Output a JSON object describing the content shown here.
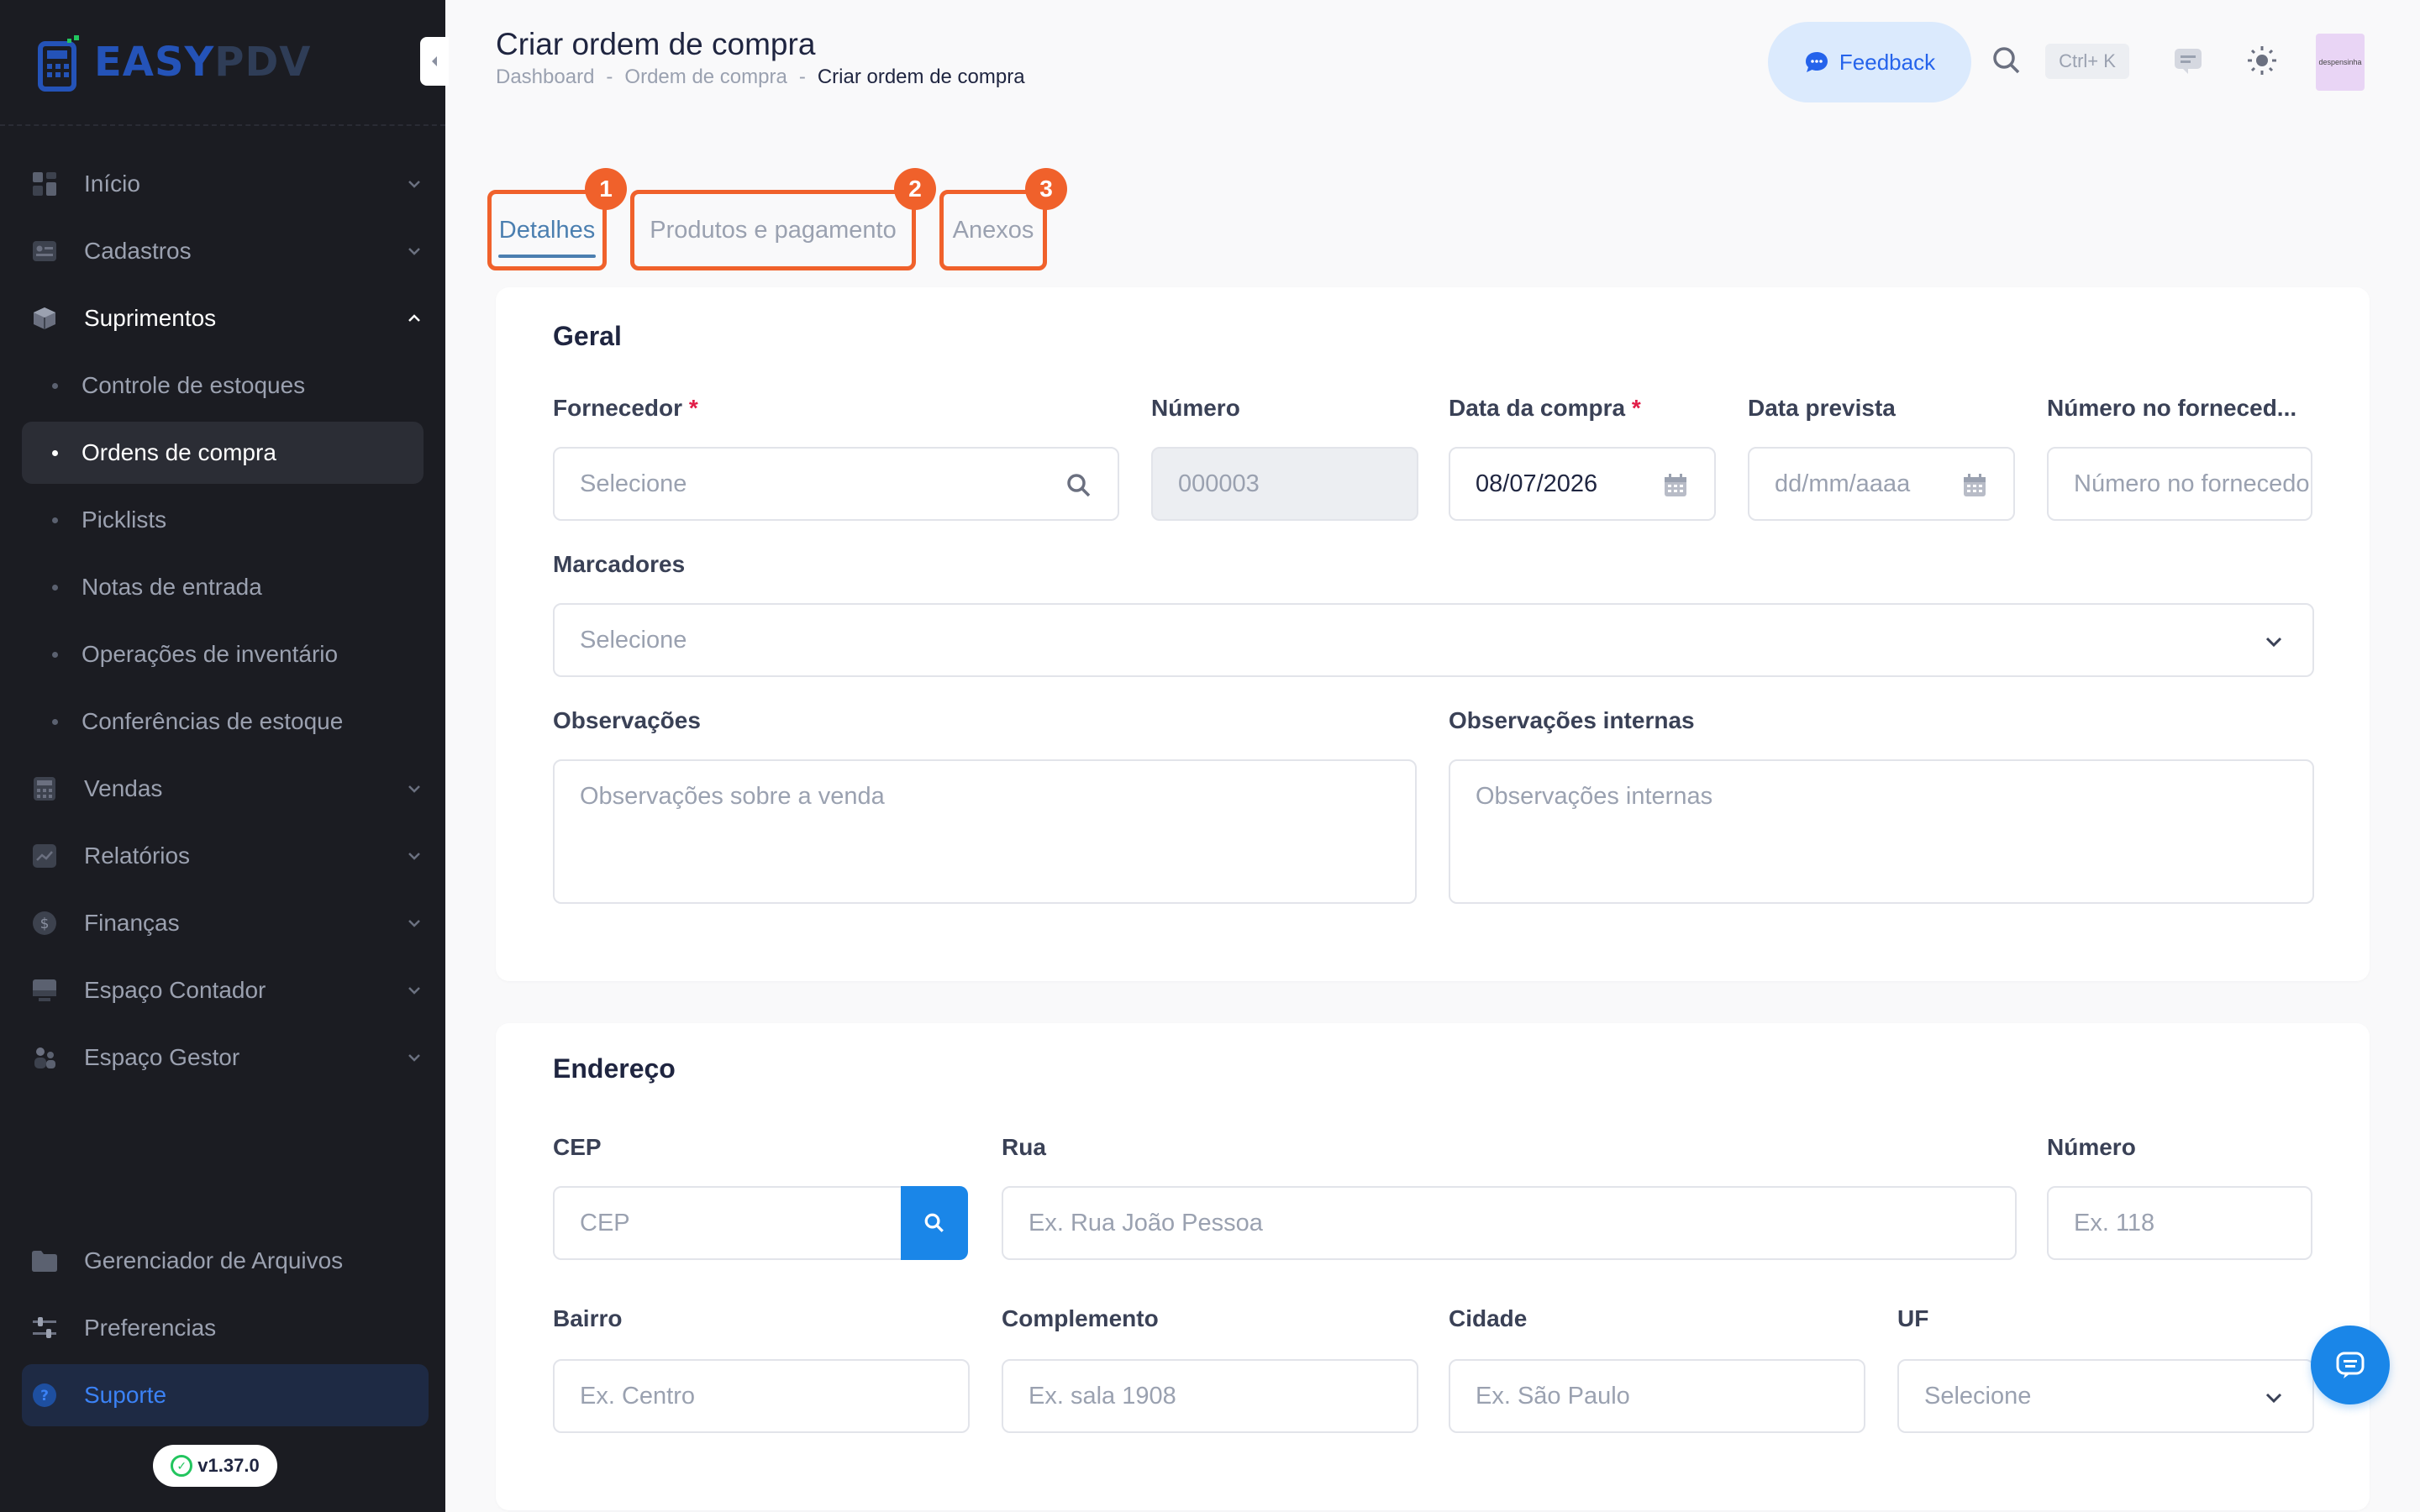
{
  "brand": {
    "name_part1": "EASY",
    "name_part2": "PDV"
  },
  "sidebar": {
    "items": [
      {
        "label": "Início"
      },
      {
        "label": "Cadastros"
      },
      {
        "label": "Suprimentos"
      },
      {
        "label": "Vendas"
      },
      {
        "label": "Relatórios"
      },
      {
        "label": "Finanças"
      },
      {
        "label": "Espaço Contador"
      },
      {
        "label": "Espaço Gestor"
      }
    ],
    "subitems": [
      {
        "label": "Controle de estoques"
      },
      {
        "label": "Ordens de compra"
      },
      {
        "label": "Picklists"
      },
      {
        "label": "Notas de entrada"
      },
      {
        "label": "Operações de inventário"
      },
      {
        "label": "Conferências de estoque"
      }
    ],
    "bottom": [
      {
        "label": "Gerenciador de Arquivos"
      },
      {
        "label": "Preferencias"
      },
      {
        "label": "Suporte"
      }
    ],
    "version": "v1.37.0"
  },
  "header": {
    "title": "Criar ordem de compra",
    "breadcrumb": [
      "Dashboard",
      "-",
      "Ordem de compra",
      "-",
      "Criar ordem de compra"
    ],
    "feedback": "Feedback",
    "shortcut": "Ctrl+ K",
    "avatar_text": "despensinha"
  },
  "tabs": [
    {
      "label": "Detalhes",
      "num": "1"
    },
    {
      "label": "Produtos e pagamento",
      "num": "2"
    },
    {
      "label": "Anexos",
      "num": "3"
    }
  ],
  "geral": {
    "title": "Geral",
    "fornecedor": {
      "label": "Fornecedor",
      "required": "*",
      "placeholder": "Selecione"
    },
    "numero": {
      "label": "Número",
      "value": "000003"
    },
    "data_compra": {
      "label": "Data da compra",
      "required": "*",
      "value": "08/07/2026"
    },
    "data_prevista": {
      "label": "Data prevista",
      "placeholder": "dd/mm/aaaa"
    },
    "numero_fornecedor": {
      "label": "Número no forneced...",
      "placeholder": "Número no fornecedor"
    },
    "marcadores": {
      "label": "Marcadores",
      "placeholder": "Selecione"
    },
    "observacoes": {
      "label": "Observações",
      "placeholder": "Observações sobre a venda"
    },
    "observacoes_internas": {
      "label": "Observações internas",
      "placeholder": "Observações internas"
    }
  },
  "endereco": {
    "title": "Endereço",
    "cep": {
      "label": "CEP",
      "placeholder": "CEP"
    },
    "rua": {
      "label": "Rua",
      "placeholder": "Ex. Rua João Pessoa"
    },
    "numero": {
      "label": "Número",
      "placeholder": "Ex. 118"
    },
    "bairro": {
      "label": "Bairro",
      "placeholder": "Ex. Centro"
    },
    "complemento": {
      "label": "Complemento",
      "placeholder": "Ex. sala 1908"
    },
    "cidade": {
      "label": "Cidade",
      "placeholder": "Ex. São Paulo"
    },
    "uf": {
      "label": "UF",
      "placeholder": "Selecione"
    }
  },
  "colors": {
    "accent": "#1a86e8",
    "highlight": "#f0612b",
    "sidebar_bg": "#1b1c22"
  }
}
